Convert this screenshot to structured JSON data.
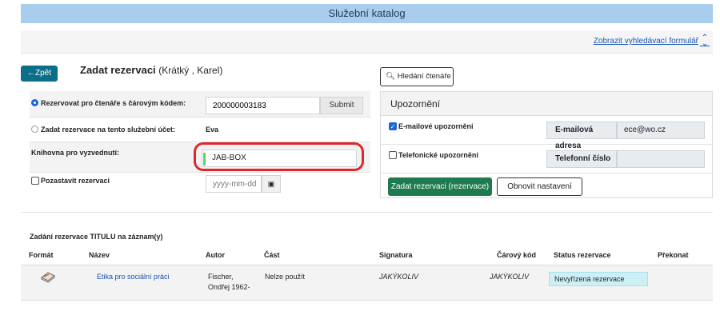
{
  "app": {
    "title": "Služební katalog"
  },
  "toolbar": {
    "advanced_search_link": "Zobrazit vyhledávací formulář",
    "advanced_icon": "chevron-up-down-icon"
  },
  "header": {
    "back_label": "←Zpět",
    "title": "Zadat rezervaci",
    "patron": "(Krátký , Karel)"
  },
  "form": {
    "rows": {
      "barcode": {
        "label": "Rezervovat pro čtenáře s čárovým kódem:",
        "value": "200000003183",
        "submit": "Submit"
      },
      "service_account": {
        "label": "Zadat rezervace na tento služební účet:",
        "value": "Eva"
      },
      "pickup": {
        "label": "Knihovna pro vyzvednutí:",
        "value": "JAB-BOX"
      },
      "suspend": {
        "label": "Pozastavit rezervaci",
        "date_placeholder": "yyyy-mm-dd"
      }
    }
  },
  "notifications": {
    "search_reader": "Hledání čtenáře",
    "heading": "Upozornění",
    "email": {
      "label": "E-mailové upozornění",
      "addon": "E-mailová adresa",
      "value": "ece@wo.cz"
    },
    "phone": {
      "label": "Telefonické upozornění",
      "addon": "Telefonní číslo",
      "value": ""
    },
    "submit": "Zadat rezervaci (rezervace)",
    "reset": "Obnovit nastavení"
  },
  "records": {
    "title": "Zadání rezervace TITULU na záznam(y)",
    "columns": [
      "Formát",
      "Název",
      "Autor",
      "Část",
      "Signatura",
      "Čárový kód",
      "Status rezervace",
      "Překonat"
    ],
    "rows": [
      {
        "format_icon": "book-icon",
        "title": "Etika pro sociální práci",
        "author_line1": "Fischer,",
        "author_line2": "Ondřej 1962-",
        "part": "Nelze použít",
        "callnumber": "JAKÝKOLIV",
        "barcode": "JAKÝKOLIV",
        "status": "Nevyřízená rezervace",
        "override": ""
      }
    ]
  },
  "colors": {
    "topbar": "#a9cdec",
    "primary": "#1e7b4f",
    "back": "#0d6e8a",
    "highlight": "#e0262b",
    "status": "#cdf0f6"
  }
}
